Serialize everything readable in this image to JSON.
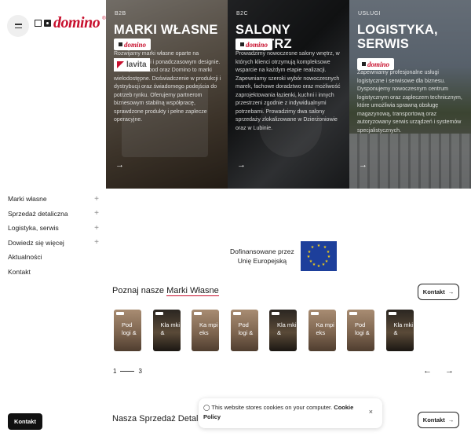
{
  "logo": {
    "text": "domino",
    "reg": "®"
  },
  "nav": [
    {
      "label": "Marki własne",
      "icon": "+"
    },
    {
      "label": "Sprzedaż detaliczna",
      "icon": "+"
    },
    {
      "label": "Logistyka, serwis",
      "icon": "+"
    },
    {
      "label": "Dowiedz się więcej",
      "icon": "+"
    },
    {
      "label": "Aktualności",
      "icon": ""
    },
    {
      "label": "Kontakt",
      "icon": ""
    }
  ],
  "kontakt_side": "Kontakt",
  "hero": [
    {
      "tag": "B2B",
      "title": "MARKI WŁASNE",
      "desc": "Rozwijamy marki własne oparte na funkcjonalności i ponadczasowym designie. Lavita, Wild Wood oraz Domino to marki wielodostępne. Doświadczenie w produkcji i dystrybucji oraz świadomego podejścia do potrzeb rynku. Oferujemy partnerom biznesowym stabilną współpracę, sprawdzone produkty i pełne zaplecze operacyjne.",
      "badge": "domino",
      "brand": "lavita",
      "arrow": "→"
    },
    {
      "tag": "B2C",
      "title": "SALONY WNĘTRZ",
      "desc": "Prowadzimy nowoczesne salony wnętrz, w których klienci otrzymują kompleksowe wsparcie na każdym etapie realizacji. Zapewniamy szeroki wybór nowoczesnych marek, fachowe doradztwo oraz możliwość zaprojektowania łazienki, kuchni i innych przestrzeni zgodnie z indywidualnymi potrzebami. Prowadzimy dwa salony sprzedaży zlokalizowane w Dzierżoniowie oraz w Lubinie.",
      "badge": "domino",
      "arrow": "→"
    },
    {
      "tag": "USŁUGI",
      "title": "LOGISTYKA, SERWIS",
      "desc": "Zapewniamy profesjonalne usługi logistyczne i serwisowe dla biznesu. Dysponujemy nowoczesnym centrum logistycznym oraz zapleczem technicznym, które umożliwia sprawną obsługę magazynową, transportową oraz autoryzowany serwis urządzeń i systemów specjalistycznych.",
      "badge": "domino",
      "arrow": "→"
    }
  ],
  "eu": {
    "line1": "Dofinansowane przez",
    "line2": "Unię Europejską"
  },
  "brands": {
    "title_prefix": "Poznaj nasze ",
    "title_highlight": "Marki Własne",
    "contact": "Kontakt",
    "arrow": "→",
    "cards": [
      {
        "label": "Pod logi &",
        "tone": "light"
      },
      {
        "label": "Kla mki &",
        "tone": "dark"
      },
      {
        "label": "Ka mpi eks",
        "tone": "light"
      },
      {
        "label": "Pod logi &",
        "tone": "light"
      },
      {
        "label": "Kla mki &",
        "tone": "dark"
      },
      {
        "label": "Ka mpi eks",
        "tone": "light"
      },
      {
        "label": "Pod logi &",
        "tone": "light"
      },
      {
        "label": "Kla mki &",
        "tone": "dark"
      }
    ],
    "page_current": "1",
    "page_total": "3",
    "prev": "←",
    "next": "→"
  },
  "sales": {
    "title": "Nasza Sprzedaż Detaliczna",
    "contact": "Kontakt"
  },
  "cookie": {
    "text": "This website stores cookies on your computer.",
    "link": "Cookie Policy",
    "close": "×"
  },
  "colors": {
    "brand_red": "#c8102e",
    "eu_blue": "#1d3f9b",
    "eu_gold": "#f7d117"
  }
}
